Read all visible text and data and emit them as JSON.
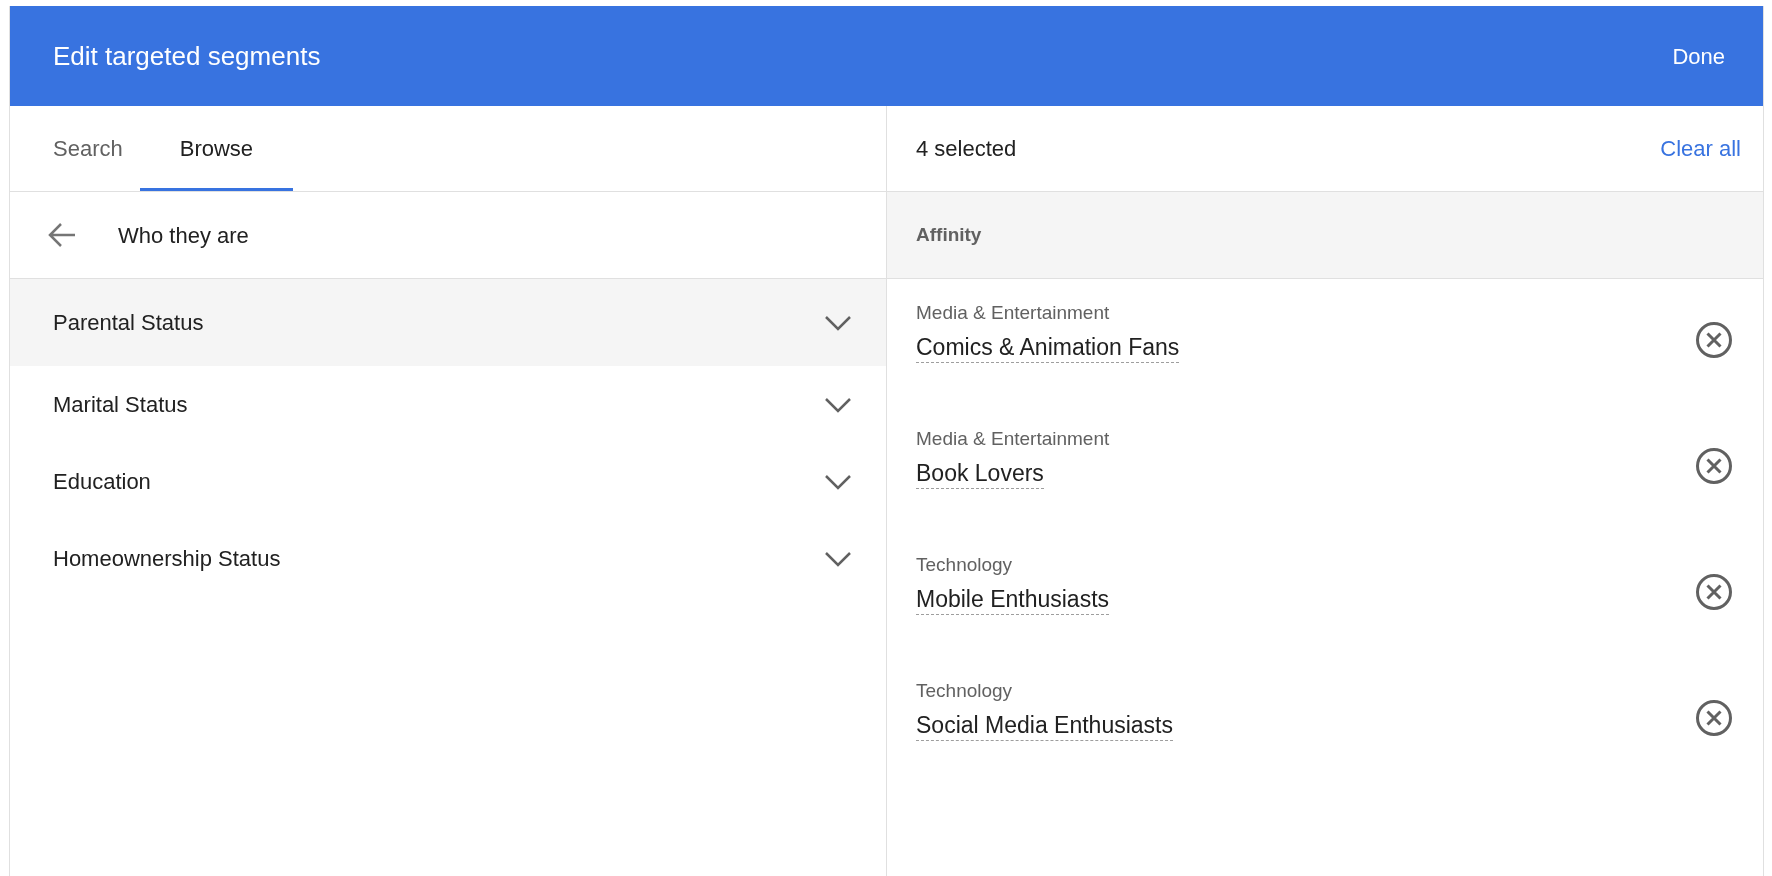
{
  "header": {
    "title": "Edit targeted segments",
    "done": "Done"
  },
  "tabs": [
    {
      "label": "Search",
      "selected": false
    },
    {
      "label": "Browse",
      "selected": true
    }
  ],
  "browse": {
    "back_label": "Who they are",
    "items": [
      {
        "label": "Parental Status",
        "highlighted": true,
        "expanded": false
      },
      {
        "label": "Marital Status",
        "highlighted": false,
        "expanded": false
      },
      {
        "label": "Education",
        "highlighted": false,
        "expanded": false
      },
      {
        "label": "Homeownership Status",
        "highlighted": false,
        "expanded": false
      }
    ]
  },
  "selection": {
    "count": "4 selected",
    "clear_all": "Clear all",
    "group": "Affinity",
    "items": [
      {
        "category": "Media & Entertainment",
        "name": "Comics & Animation Fans"
      },
      {
        "category": "Media & Entertainment",
        "name": "Book Lovers"
      },
      {
        "category": "Technology",
        "name": "Mobile Enthusiasts"
      },
      {
        "category": "Technology",
        "name": "Social Media Enthusiasts"
      }
    ]
  }
}
